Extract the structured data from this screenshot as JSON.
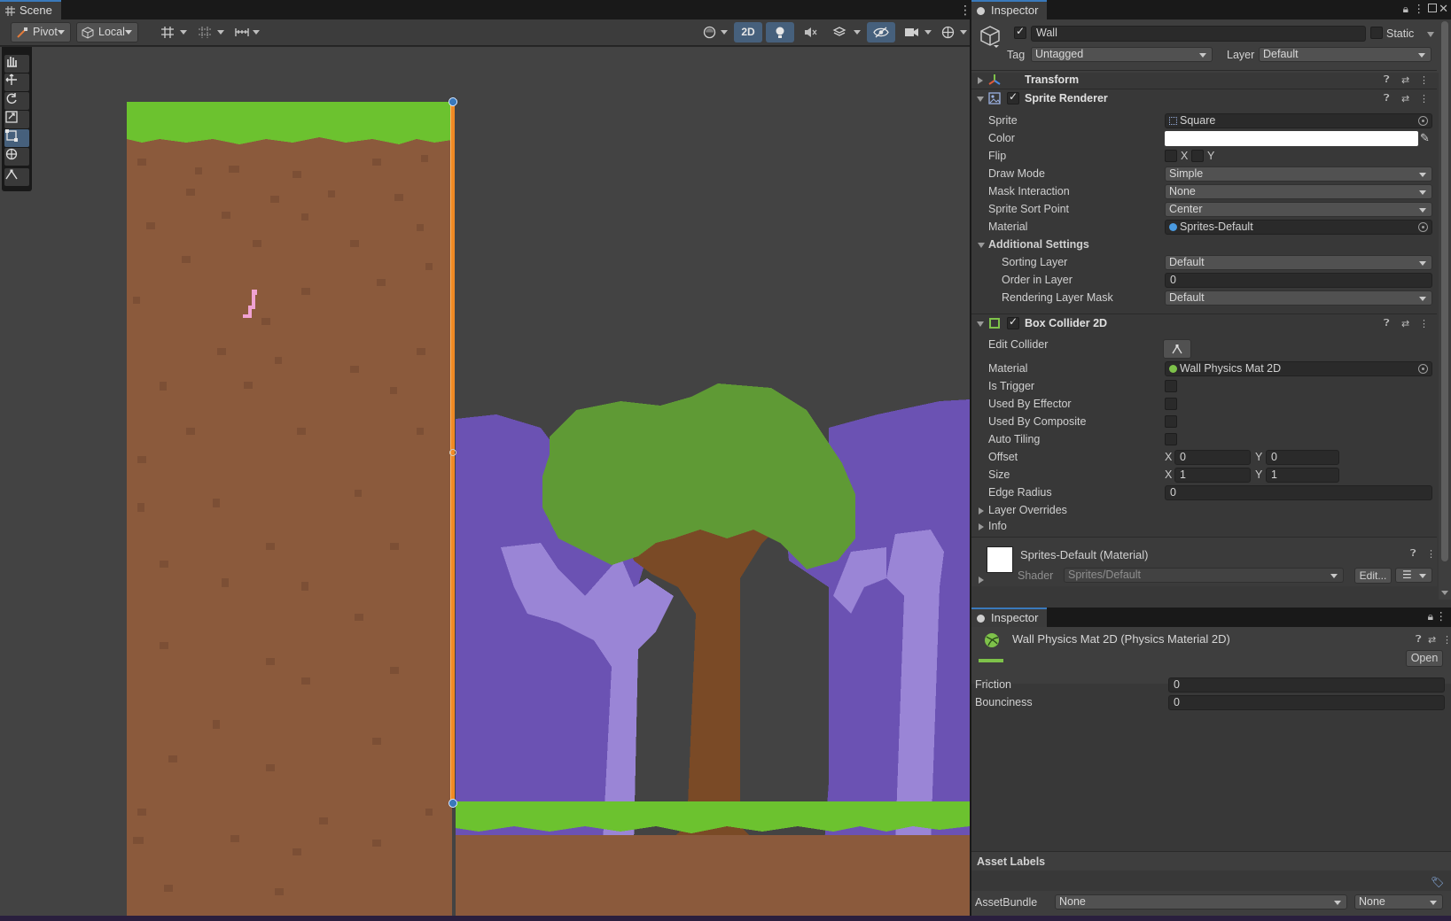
{
  "scene": {
    "tab_label": "Scene",
    "toolbar": {
      "pivot_label": "Pivot",
      "local_label": "Local",
      "twod_label": "2D"
    }
  },
  "inspector": {
    "tab_label": "Inspector",
    "object": {
      "name": "Wall",
      "static_label": "Static",
      "tag_label": "Tag",
      "tag_value": "Untagged",
      "layer_label": "Layer",
      "layer_value": "Default"
    },
    "transform": {
      "title": "Transform"
    },
    "sprite_renderer": {
      "title": "Sprite Renderer",
      "sprite_label": "Sprite",
      "sprite_value": "Square",
      "color_label": "Color",
      "color_value": "#ffffff",
      "flip_label": "Flip",
      "flip_x": "X",
      "flip_y": "Y",
      "draw_mode_label": "Draw Mode",
      "draw_mode_value": "Simple",
      "mask_label": "Mask Interaction",
      "mask_value": "None",
      "sort_point_label": "Sprite Sort Point",
      "sort_point_value": "Center",
      "material_label": "Material",
      "material_value": "Sprites-Default",
      "additional_label": "Additional Settings",
      "sorting_layer_label": "Sorting Layer",
      "sorting_layer_value": "Default",
      "order_label": "Order in Layer",
      "order_value": "0",
      "render_mask_label": "Rendering Layer Mask",
      "render_mask_value": "Default"
    },
    "box_collider": {
      "title": "Box Collider 2D",
      "edit_label": "Edit Collider",
      "material_label": "Material",
      "material_value": "Wall Physics Mat 2D",
      "trigger_label": "Is Trigger",
      "effector_label": "Used By Effector",
      "composite_label": "Used By Composite",
      "tiling_label": "Auto Tiling",
      "offset_label": "Offset",
      "offset_x": "0",
      "offset_y": "0",
      "size_label": "Size",
      "size_x": "1",
      "size_y": "1",
      "edge_label": "Edge Radius",
      "edge_value": "0",
      "axis_x": "X",
      "axis_y": "Y",
      "overrides_label": "Layer Overrides",
      "info_label": "Info"
    },
    "material_preview": {
      "title": "Sprites-Default (Material)",
      "shader_label": "Shader",
      "shader_value": "Sprites/Default",
      "edit_button": "Edit..."
    }
  },
  "inspector2": {
    "tab_label": "Inspector",
    "asset_title": "Wall Physics Mat 2D (Physics Material 2D)",
    "open_button": "Open",
    "friction_label": "Friction",
    "friction_value": "0",
    "bounciness_label": "Bounciness",
    "bounciness_value": "0",
    "asset_labels_label": "Asset Labels",
    "assetbundle_label": "AssetBundle",
    "assetbundle_value": "None",
    "variant_value": "None"
  },
  "colors": {
    "accent": "#3a79bb",
    "selection_outline": "#f08a24",
    "dirt": "#8b5a3c",
    "grass": "#6cc22f",
    "tree_dark": "#6b52b3",
    "tree_light": "#9a85d6",
    "leaves": "#5f9a35",
    "trunk": "#7a4a26"
  }
}
